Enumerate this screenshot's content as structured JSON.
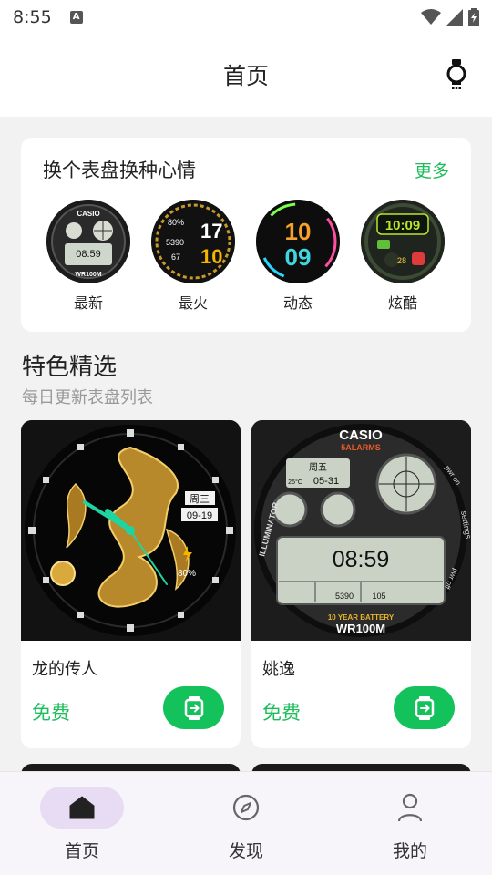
{
  "status_bar": {
    "time": "8:55",
    "notification_icon": "A"
  },
  "header": {
    "title": "首页"
  },
  "mood_card": {
    "title": "换个表盘换种心情",
    "more": "更多",
    "categories": [
      {
        "label": "最新"
      },
      {
        "label": "最火"
      },
      {
        "label": "动态"
      },
      {
        "label": "炫酷"
      }
    ]
  },
  "featured": {
    "title": "特色精选",
    "subtitle": "每日更新表盘列表",
    "items": [
      {
        "name": "龙的传人",
        "price": "免费"
      },
      {
        "name": "姚逸",
        "price": "免费"
      }
    ]
  },
  "faces": {
    "newest": {
      "brand": "CASIO",
      "time": "08:59",
      "model": "WR100M"
    },
    "hottest": {
      "pct": "80%",
      "steps": "5390",
      "hr": "67",
      "hour": "17",
      "minute": "10"
    },
    "dynamic": {
      "hour": "10",
      "minute": "09"
    },
    "cool": {
      "time": "10:09",
      "temp": "28"
    },
    "dragon": {
      "day": "周三",
      "date": "09-19",
      "battery": "80%"
    },
    "casio": {
      "brand": "CASIO",
      "alarms": "5ALARMS",
      "day": "周五",
      "temp": "25°C",
      "date": "05-31",
      "time": "08:59",
      "steps": "5390",
      "hr": "105",
      "battery_text": "10 YEAR BATTERY",
      "model": "WR100M",
      "illuminator": "ILLUMINATOR",
      "settings": "settings",
      "power_on": "pwr on",
      "power_off": "pwr off"
    }
  },
  "bottom_nav": {
    "items": [
      {
        "label": "首页",
        "active": true
      },
      {
        "label": "发现",
        "active": false
      },
      {
        "label": "我的",
        "active": false
      }
    ]
  },
  "colors": {
    "accent_green": "#1dbd5c",
    "nav_active_bg": "#e7dcf3"
  }
}
